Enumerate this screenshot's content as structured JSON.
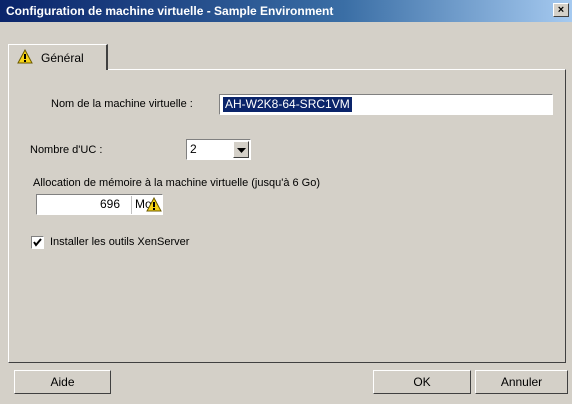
{
  "window": {
    "title": "Configuration de machine virtuelle - Sample Environment",
    "close_label": "×"
  },
  "tab": {
    "label": "Général",
    "icon": "warning-icon"
  },
  "form": {
    "vm_name_label": "Nom de la machine virtuelle :",
    "vm_name_value": "AH-W2K8-64-SRC1VM",
    "cpu_label": "Nombre d'UC :",
    "cpu_value": "2",
    "memory_label": "Allocation de mémoire à la machine virtuelle (jusqu'à 6 Go)",
    "memory_value": "696",
    "memory_unit": "Mo",
    "memory_warning_icon": "warning-icon",
    "tools_label": "Installer les outils XenServer",
    "tools_checked": true
  },
  "buttons": {
    "help": "Aide",
    "ok": "OK",
    "cancel": "Annuler"
  },
  "colors": {
    "title_bar": "#0a246a",
    "selection": "#0a246a",
    "warning": "#f7d417"
  }
}
